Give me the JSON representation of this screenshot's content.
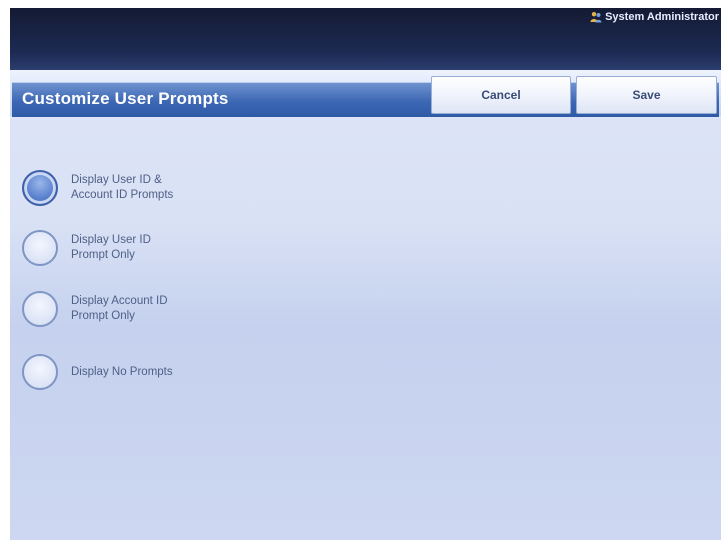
{
  "header": {
    "user": "System Administrator",
    "user_icon": "user-group-icon"
  },
  "title": "Customize User Prompts",
  "buttons": {
    "cancel": "Cancel",
    "save": "Save"
  },
  "options": [
    {
      "label": "Display User ID &\nAccount ID Prompts",
      "selected": true
    },
    {
      "label": "Display User ID\nPrompt Only",
      "selected": false
    },
    {
      "label": "Display Account ID\nPrompt Only",
      "selected": false
    },
    {
      "label": "Display No Prompts",
      "selected": false
    }
  ],
  "colors": {
    "accent": "#3c67b4",
    "topbar": "#1c2a52",
    "background": "#d9e1f5"
  }
}
